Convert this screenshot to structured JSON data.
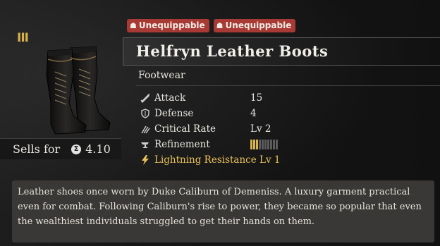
{
  "item": {
    "tier": "III",
    "sells_label": "Sells for",
    "sells_value": "4.10",
    "coin_icon": "coin-icon"
  },
  "badges": [
    {
      "label": "Unequippable",
      "icon": "character-icon"
    },
    {
      "label": "Unequippable",
      "icon": "character-icon"
    }
  ],
  "title": "Helfryn Leather Boots",
  "category": "Footwear",
  "stats": [
    {
      "label": "Attack",
      "value": "15",
      "icon": "sword-icon"
    },
    {
      "label": "Defense",
      "value": "4",
      "icon": "shield-icon"
    },
    {
      "label": "Critical Rate",
      "value": "Lv 2",
      "icon": "claw-icon"
    },
    {
      "label": "Refinement",
      "value": "",
      "icon": "anvil-icon",
      "refinement_level": 3,
      "refinement_max": 10
    }
  ],
  "bonus": {
    "label": "Lightning Resistance Lv 1",
    "icon": "lightning-icon"
  },
  "description": "Leather shoes once worn by Duke Caliburn of Demeniss. A luxury garment practical even for combat. Following Caliburn's rise to power, they became so popular that even the wealthiest individuals struggled to get their hands on them.",
  "colors": {
    "badge": "#a73a34",
    "tier": "#d8b24a",
    "bonus": "#e8c15a"
  }
}
